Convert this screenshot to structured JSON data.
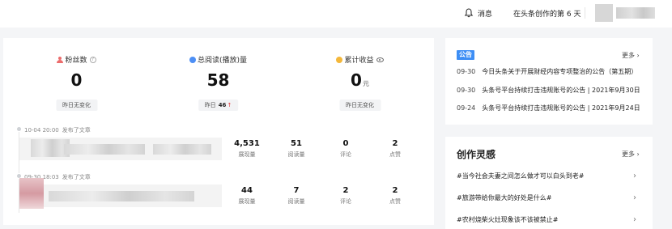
{
  "topbar": {
    "icon": "bell-icon",
    "message_label": "消息",
    "days_label": "在头条创作的第 6 天"
  },
  "stats": [
    {
      "label": "粉丝数",
      "icon": "user-icon",
      "value": "0",
      "unit": "",
      "compare_label": "昨日无变化",
      "compare_value": "",
      "trend": ""
    },
    {
      "label": "总阅读(播放)量",
      "icon": "read-icon",
      "value": "58",
      "unit": "",
      "compare_label": "昨日",
      "compare_value": "46",
      "trend": "↑"
    },
    {
      "label": "累计收益",
      "icon": "coin-icon",
      "value": "0",
      "unit": "元",
      "compare_label": "昨日无变化",
      "compare_value": "",
      "trend": ""
    }
  ],
  "articles": [
    {
      "time": "10-04 20:00",
      "action": "发布了文章",
      "metrics": [
        {
          "value": "4,531",
          "label": "展现量"
        },
        {
          "value": "51",
          "label": "阅读量"
        },
        {
          "value": "0",
          "label": "评论"
        },
        {
          "value": "2",
          "label": "点赞"
        }
      ]
    },
    {
      "time": "09-30 18:03",
      "action": "发布了文章",
      "metrics": [
        {
          "value": "44",
          "label": "展现量"
        },
        {
          "value": "7",
          "label": "阅读量"
        },
        {
          "value": "2",
          "label": "评论"
        },
        {
          "value": "2",
          "label": "点赞"
        }
      ]
    }
  ],
  "notices": {
    "badge": "公告",
    "more": "更多",
    "items": [
      {
        "date": "09-30",
        "title": "今日头条关于开展财经内容专项整治的公告（第五期）"
      },
      {
        "date": "09-30",
        "title": "头条号平台持续打击违规账号的公告 | 2021年9月30日"
      },
      {
        "date": "09-24",
        "title": "头条号平台持续打击违规账号的公告 | 2021年9月24日"
      }
    ]
  },
  "inspiration": {
    "title": "创作灵感",
    "more": "更多",
    "topics": [
      "#当今社会夫妻之间怎么做才可以白头到老#",
      "#旅游带给你最大的好处是什么#",
      "#农村烧柴火灶现象该不该被禁止#"
    ]
  }
}
